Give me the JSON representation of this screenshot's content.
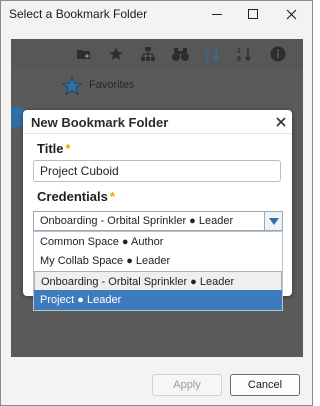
{
  "window": {
    "title": "Select a Bookmark Folder"
  },
  "toolbar": {
    "icons": [
      "add-folder-icon",
      "star-icon",
      "network-icon",
      "binoculars-icon",
      "sort-az-icon",
      "sort-numeric-icon",
      "info-icon"
    ]
  },
  "tree": {
    "favorites_label": "Favorites"
  },
  "dialog": {
    "title": "New Bookmark Folder",
    "title_label": "Title",
    "title_value": "Project Cuboid",
    "credentials_label": "Credentials",
    "required_mark": "*",
    "selected_credential": "Onboarding - Orbital Sprinkler ● Leader",
    "options": [
      "Common Space ● Author",
      "My Collab Space ● Leader",
      "Onboarding - Orbital Sprinkler ● Leader",
      "Project ● Leader"
    ]
  },
  "footer": {
    "apply_label": "Apply",
    "cancel_label": "Cancel"
  },
  "colors": {
    "accent": "#3d7bbd",
    "required": "#f0a800",
    "overlay": "#5a5a5a"
  }
}
